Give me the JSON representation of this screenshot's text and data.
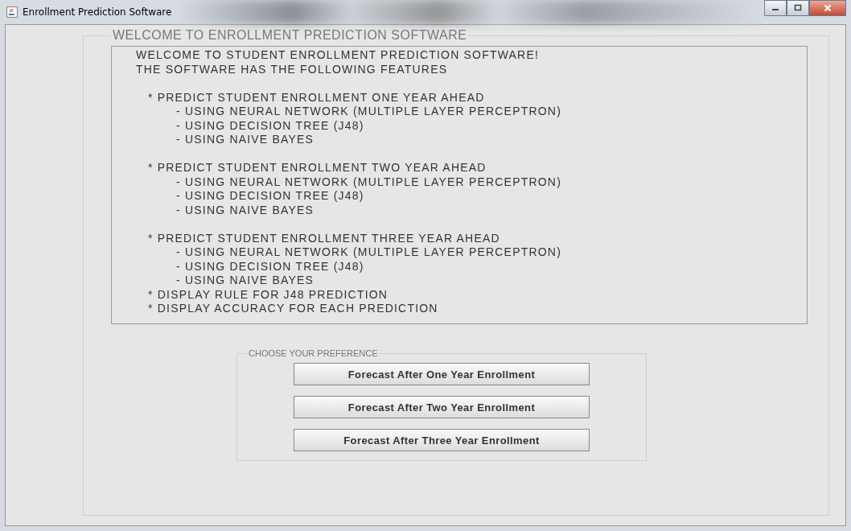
{
  "window": {
    "title": "Enrollment Prediction Software"
  },
  "welcome_group": {
    "title": "WELCOME TO ENROLLMENT PREDICTION SOFTWARE"
  },
  "features_text": [
    {
      "lines": [
        {
          "kind": "heading",
          "text": "WELCOME TO STUDENT ENROLLMENT PREDICTION  SOFTWARE!"
        },
        {
          "kind": "heading",
          "text": "THE SOFTWARE HAS THE FOLLOWING FEATURES"
        }
      ]
    },
    {
      "lines": [
        {
          "kind": "feature",
          "text": "* PREDICT STUDENT ENROLLMENT ONE YEAR AHEAD"
        },
        {
          "kind": "sub",
          "text": "- USING NEURAL NETWORK (MULTIPLE LAYER PERCEPTRON)"
        },
        {
          "kind": "sub",
          "text": "- USING DECISION TREE (J48)"
        },
        {
          "kind": "sub",
          "text": "- USING NAIVE BAYES"
        }
      ]
    },
    {
      "lines": [
        {
          "kind": "feature",
          "text": "* PREDICT STUDENT ENROLLMENT TWO YEAR AHEAD"
        },
        {
          "kind": "sub",
          "text": "- USING NEURAL NETWORK (MULTIPLE LAYER PERCEPTRON)"
        },
        {
          "kind": "sub",
          "text": "- USING DECISION TREE (J48)"
        },
        {
          "kind": "sub",
          "text": "- USING NAIVE BAYES"
        }
      ]
    },
    {
      "lines": [
        {
          "kind": "feature",
          "text": "* PREDICT STUDENT ENROLLMENT THREE YEAR AHEAD"
        },
        {
          "kind": "sub",
          "text": "- USING NEURAL NETWORK (MULTIPLE LAYER PERCEPTRON)"
        },
        {
          "kind": "sub",
          "text": "- USING DECISION TREE (J48)"
        },
        {
          "kind": "sub",
          "text": "- USING NAIVE BAYES"
        },
        {
          "kind": "feature",
          "text": "* DISPLAY RULE FOR J48 PREDICTION"
        },
        {
          "kind": "feature",
          "text": "* DISPLAY ACCURACY FOR EACH PREDICTION"
        }
      ]
    }
  ],
  "preference_group": {
    "title": "CHOOSE YOUR PREFERENCE",
    "buttons": [
      "Forecast After One Year Enrollment",
      "Forecast After Two Year Enrollment",
      "Forecast After Three Year Enrollment"
    ]
  }
}
